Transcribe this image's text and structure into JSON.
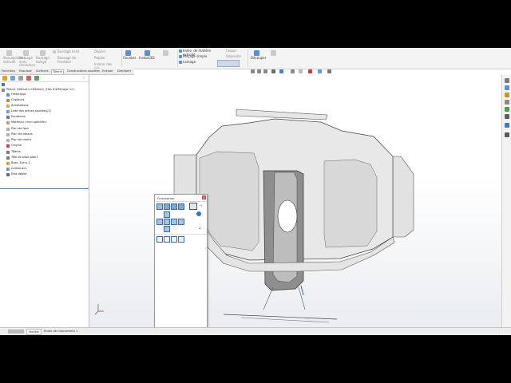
{
  "ribbon": {
    "group1": [
      "Bossage/base extrudé",
      "Bossage avec révolution",
      "Bossage balayé",
      "Bossage lissé",
      "Bossage de frontière"
    ],
    "group1_right": [
      "Enlèv. de matière extrudé",
      "Enlèv. de matière avec révolution",
      "Assistance",
      "Enlèv. de matière balayé",
      "Enlèv. de matière lissé",
      "Enlèv. de matière de frontière"
    ],
    "curves_label": "Courbes",
    "instant3d_label": "Instant3D",
    "tolerie": [
      "Enlèv. de matière extrudé",
      "Perçage simple",
      "Lamage"
    ],
    "right_items": [
      "Coque",
      "Dépouille",
      "Découper"
    ],
    "extra": [
      "Déplier",
      "Replier",
      "Insérer des plis"
    ]
  },
  "tabs": [
    "Fonctions",
    "Esquisse",
    "Surfaces",
    "Tôlerie",
    "Constructions soudées",
    "Evaluer",
    "DimXpert"
  ],
  "active_tab": "Tôlerie",
  "tree": {
    "root": "Pièce1  (Défaut<<Défaut>_Etat d'affichage 1>)",
    "items": [
      "Historique",
      "Capteurs",
      "Annotations",
      "Liste des pièces soudées(1)",
      "Equations",
      "Matériau <non spécifié>",
      "Plan de face",
      "Plan de dessus",
      "Plan de droite",
      "Origine",
      "Tôlerie",
      "Tôle de base-plier1",
      "Boss.-Extru.1",
      "Combiner1",
      "Etat déplié"
    ]
  },
  "orientation": {
    "title": "Orientation"
  },
  "bottom_tabs": [
    "Modèle",
    "Etude de mouvement 1"
  ],
  "colors": {
    "accent": "#4a7fd0",
    "panel_line": "#4a7fd0",
    "model_fill": "#dcdcdc",
    "model_dark": "#8a8a8a",
    "select_blue": "#3060d0"
  }
}
